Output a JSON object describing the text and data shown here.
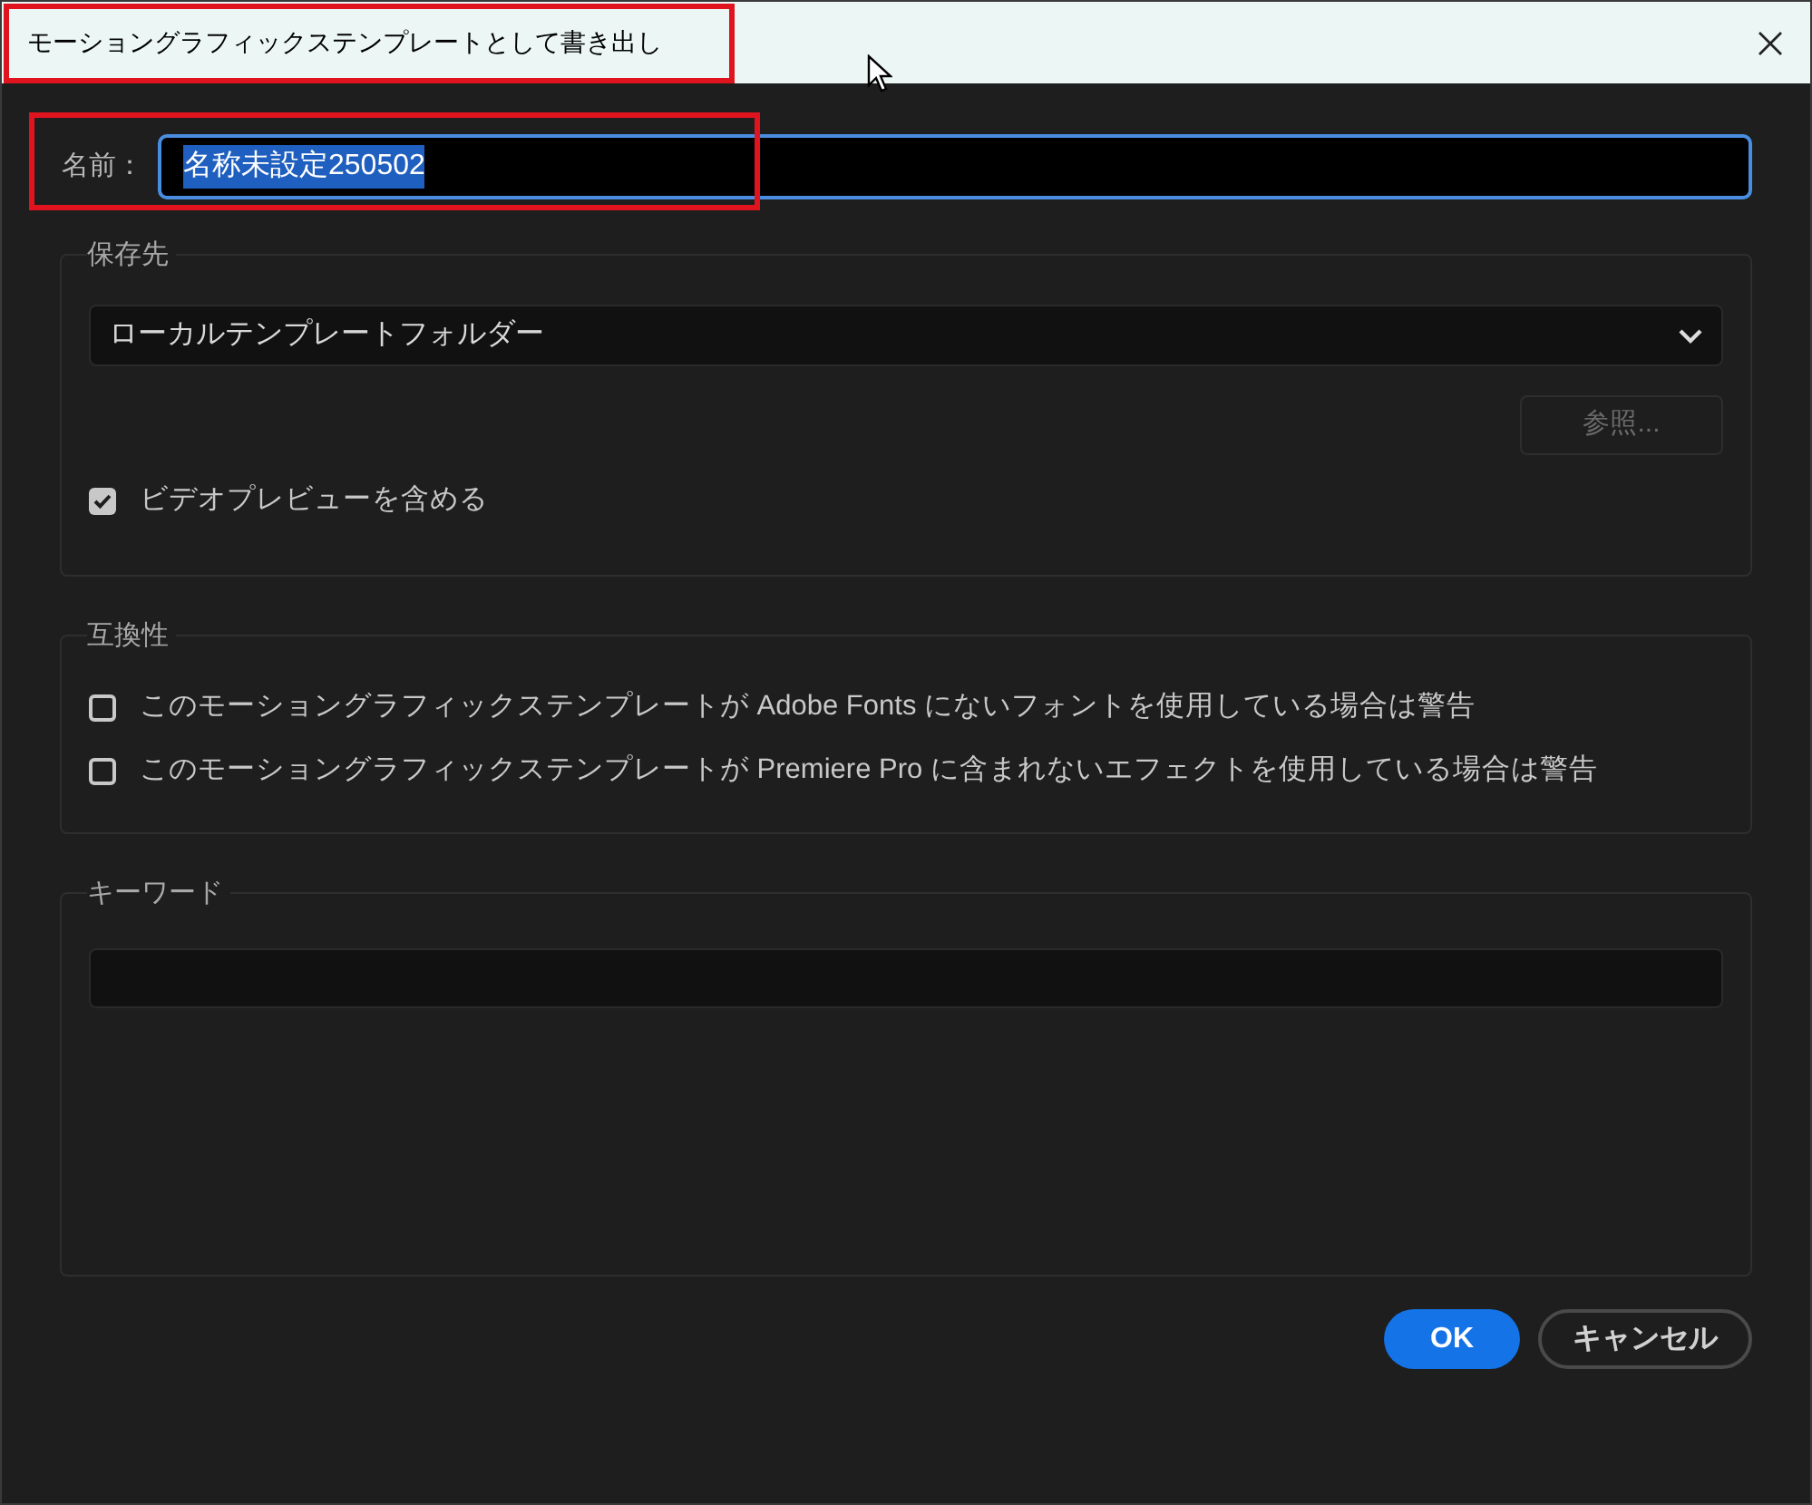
{
  "window": {
    "title": "モーショングラフィックステンプレートとして書き出し"
  },
  "name": {
    "label": "名前：",
    "value": "名称未設定250502",
    "text_selected": true
  },
  "destination": {
    "legend": "保存先",
    "dropdown": "ローカルテンプレートフォルダー",
    "browse": {
      "label": "参照...",
      "disabled": true
    },
    "checkboxes": [
      {
        "label": "ビデオプレビューを含める",
        "checked": true
      }
    ]
  },
  "compatibility": {
    "legend": "互換性",
    "checkboxes": [
      {
        "label": "このモーショングラフィックステンプレートが Adobe Fonts にないフォントを使用している場合は警告",
        "checked": false
      },
      {
        "label": "このモーショングラフィックステンプレートが Premiere Pro に含まれないエフェクトを使用している場合は警告",
        "checked": false
      }
    ]
  },
  "keywords": {
    "legend": "キーワード"
  },
  "buttons": [
    {
      "label": "OK",
      "kind": "primary"
    },
    {
      "label": "キャンセル",
      "kind": "secondary"
    }
  ]
}
